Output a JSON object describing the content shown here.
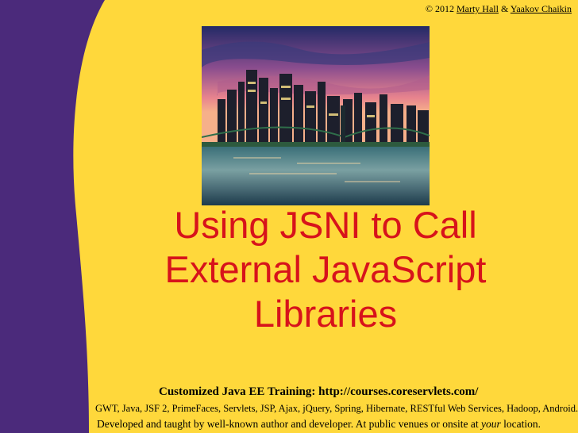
{
  "copyright": {
    "prefix": "© 2012",
    "author1": "Marty Hall",
    "amp": "&",
    "author2": "Yaakov Chaikin"
  },
  "image": {
    "subject": "city-skyline-bridge-night-photo"
  },
  "title": {
    "line1": "Using JSNI to Call",
    "line2": "External JavaScript",
    "line3": "Libraries"
  },
  "footer": {
    "course": "Customized Java EE Training: http://courses.coreservlets.com/",
    "topics": "GWT, Java, JSF 2, PrimeFaces, Servlets, JSP, Ajax, jQuery, Spring, Hibernate, RESTful Web Services, Hadoop, Android.",
    "dev_before": "Developed and taught by well-known author and developer. At public venues or onsite at ",
    "dev_emph": "your",
    "dev_after": " location."
  },
  "colors": {
    "background": "#ffd83b",
    "purple": "#4b2a7b",
    "title": "#d7131b"
  }
}
